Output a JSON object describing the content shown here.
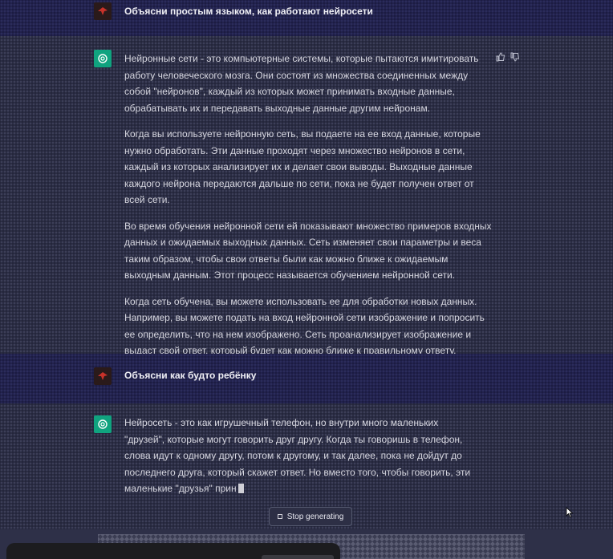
{
  "conversation": {
    "first_question": "Объясни простым языком, как работают нейросети",
    "first_answer": [
      "Нейронные сети - это компьютерные системы, которые пытаются имитировать работу человеческого мозга. Они состоят из множества соединенных между собой \"нейронов\", каждый из которых может принимать входные данные, обрабатывать их и передавать выходные данные другим нейронам.",
      "Когда вы используете нейронную сеть, вы подаете на ее вход данные, которые нужно обработать. Эти данные проходят через множество нейронов в сети, каждый из которых анализирует их и делает свои выводы. Выходные данные каждого нейрона передаются дальше по сети, пока не будет получен ответ от всей сети.",
      "Во время обучения нейронной сети ей показывают множество примеров входных данных и ожидаемых выходных данных. Сеть изменяет свои параметры и веса таким образом, чтобы свои ответы были как можно ближе к ожидаемым выходным данным. Этот процесс называется обучением нейронной сети.",
      "Когда сеть обучена, вы можете использовать ее для обработки новых данных. Например, вы можете подать на вход нейронной сети изображение и попросить ее определить, что на нем изображено. Сеть проанализирует изображение и выдаст свой ответ, который будет как можно ближе к правильному ответу."
    ],
    "second_question": "Объясни как будто ребёнку",
    "second_answer": "Нейросеть - это как игрушечный телефон, но внутри много маленьких \"друзей\", которые могут говорить друг другу. Когда ты говоришь в телефон, слова идут к одному другу, потом к другому, и так далее, пока не дойдут до последнего друга, который скажет ответ. Но вместо того, чтобы говорить, эти маленькие \"друзья\" прин"
  },
  "controls": {
    "stop_label": "Stop generating"
  },
  "icons": {
    "user_avatar": "user-avatar-icon",
    "bot_avatar": "openai-logo-icon",
    "thumbs_up": "thumbs-up-icon",
    "thumbs_down": "thumbs-down-icon",
    "stop": "stop-square-icon",
    "cursor": "mouse-pointer-icon"
  },
  "colors": {
    "accent_green": "#10a37f",
    "user_band": "#22224e",
    "background": "#2b2d44"
  }
}
